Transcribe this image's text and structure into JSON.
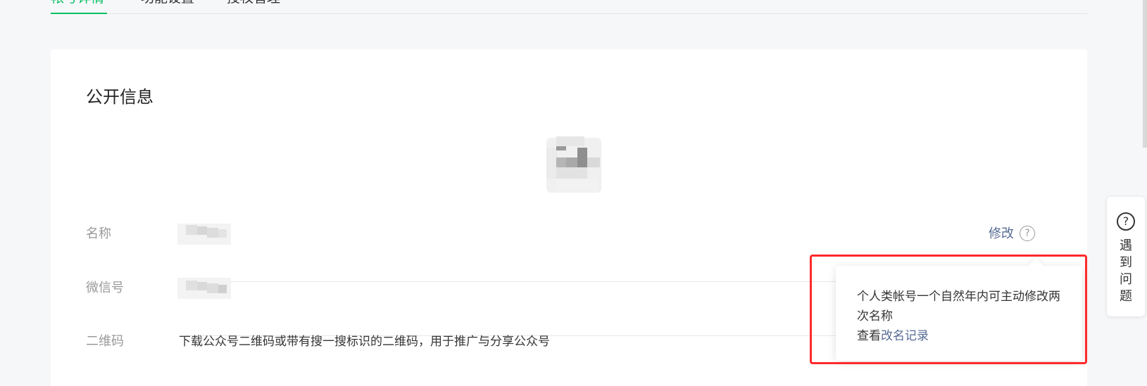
{
  "tabs": [
    {
      "label": "帐号详情",
      "active": true
    },
    {
      "label": "功能设置",
      "active": false
    },
    {
      "label": "授权管理",
      "active": false
    }
  ],
  "section": {
    "title": "公开信息"
  },
  "rows": {
    "name": {
      "label": "名称",
      "edit": "修改",
      "help": "?"
    },
    "wechat_id": {
      "label": "微信号"
    },
    "qrcode": {
      "label": "二维码",
      "value": "下载公众号二维码或带有搜一搜标识的二维码，用于推广与分享公众号"
    }
  },
  "popover": {
    "line1": "个人类帐号一个自然年内可主动修改两次名称",
    "view_prefix": "查看",
    "view_link": "改名记录"
  },
  "side_help": {
    "icon": "?",
    "label_chars": [
      "遇",
      "到",
      "问",
      "题"
    ]
  },
  "colors": {
    "accent": "#07c160",
    "link": "#576b95",
    "highlight": "#ff2a2a"
  }
}
